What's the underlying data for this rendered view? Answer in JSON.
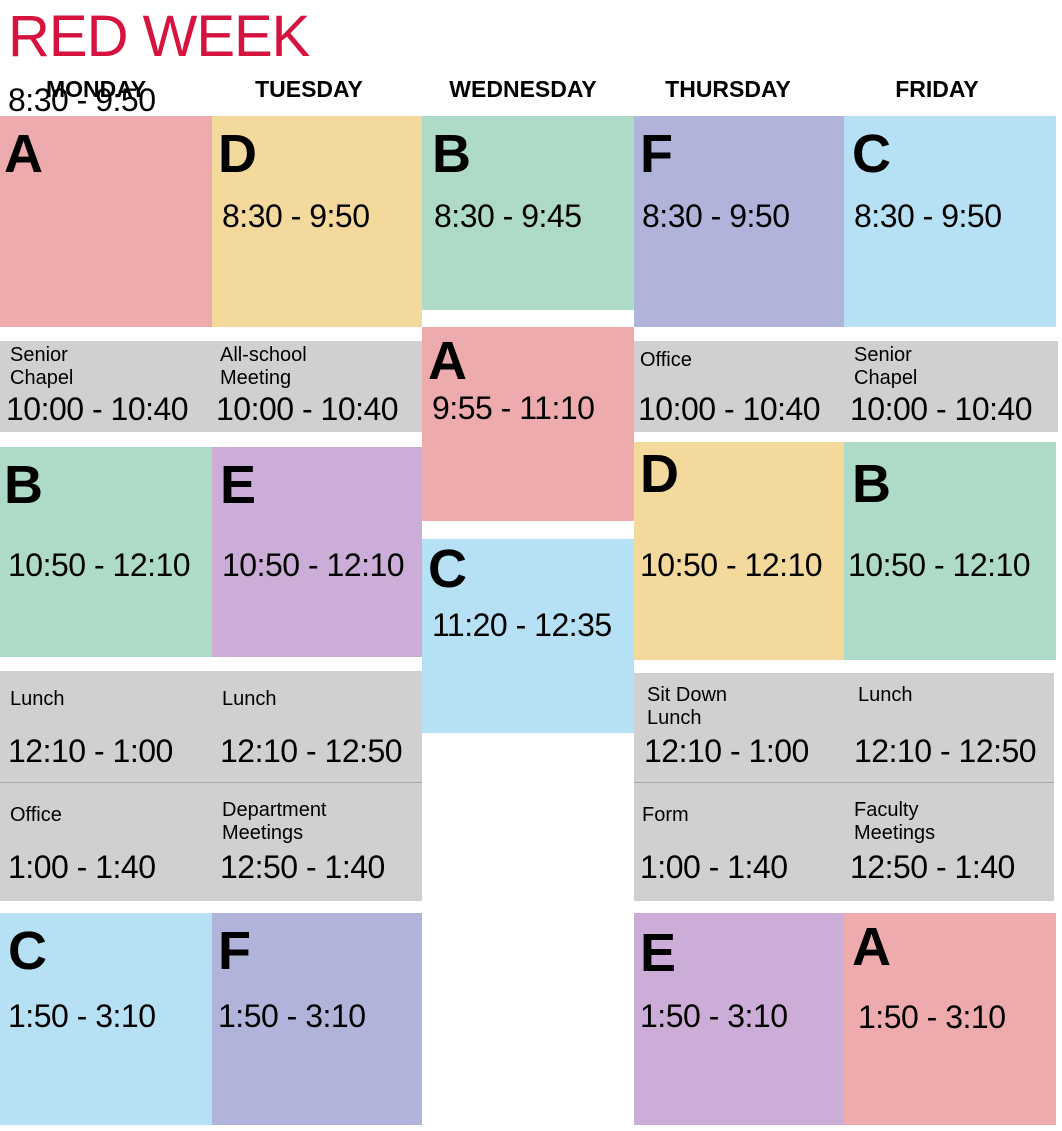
{
  "title": "RED WEEK",
  "days": [
    "MONDAY",
    "TUESDAY",
    "WEDNESDAY",
    "THURSDAY",
    "FRIDAY"
  ],
  "colors": {
    "A": "#eeabad",
    "B": "#addbc8",
    "C": "#b6e1f4",
    "D": "#f3d99c",
    "E": "#cbadd7",
    "F": "#b0b4db",
    "gray": "#d0d0d0",
    "title": "#d6123f"
  },
  "monday": {
    "p1": {
      "letter": "A",
      "time": "8:30 - 9:50"
    },
    "chapel": {
      "label": "Senior\nChapel",
      "time": "10:00 - 10:40"
    },
    "p2": {
      "letter": "B",
      "time": "10:50 - 12:10"
    },
    "lunch": {
      "label": "Lunch",
      "time": "12:10 - 1:00"
    },
    "office": {
      "label": "Office",
      "time": "1:00 - 1:40"
    },
    "p3": {
      "letter": "C",
      "time": "1:50 - 3:10"
    }
  },
  "tuesday": {
    "p1": {
      "letter": "D",
      "time": "8:30 - 9:50"
    },
    "meeting": {
      "label": "All-school\nMeeting",
      "time": "10:00 - 10:40"
    },
    "p2": {
      "letter": "E",
      "time": "10:50 - 12:10"
    },
    "lunch": {
      "label": "Lunch",
      "time": "12:10 - 12:50"
    },
    "dept": {
      "label": "Department\nMeetings",
      "time": "12:50 - 1:40"
    },
    "p3": {
      "letter": "F",
      "time": "1:50 - 3:10"
    }
  },
  "wednesday": {
    "p1": {
      "letter": "B",
      "time": "8:30 - 9:45"
    },
    "p2": {
      "letter": "A",
      "time": "9:55 - 11:10"
    },
    "p3": {
      "letter": "C",
      "time": "11:20 - 12:35"
    }
  },
  "thursday": {
    "p1": {
      "letter": "F",
      "time": "8:30 - 9:50"
    },
    "office": {
      "label": "Office",
      "time": "10:00 - 10:40"
    },
    "p2": {
      "letter": "D",
      "time": "10:50 - 12:10"
    },
    "lunch": {
      "label": "Sit Down\nLunch",
      "time": "12:10 - 1:00"
    },
    "form": {
      "label": "Form",
      "time": "1:00 - 1:40"
    },
    "p3": {
      "letter": "E",
      "time": "1:50 - 3:10"
    }
  },
  "friday": {
    "p1": {
      "letter": "C",
      "time": "8:30 - 9:50"
    },
    "chapel": {
      "label": "Senior\nChapel",
      "time": "10:00 - 10:40"
    },
    "p2": {
      "letter": "B",
      "time": "10:50 - 12:10"
    },
    "lunch": {
      "label": "Lunch",
      "time": "12:10 - 12:50"
    },
    "faculty": {
      "label": "Faculty\nMeetings",
      "time": "12:50 - 1:40"
    },
    "p3": {
      "letter": "A",
      "time": "1:50 - 3:10"
    }
  }
}
